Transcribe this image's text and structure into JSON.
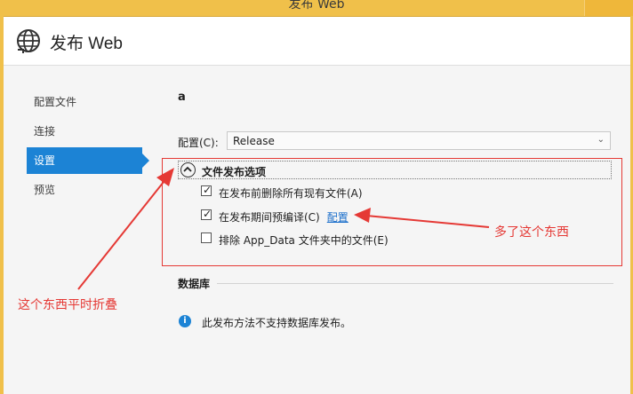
{
  "window": {
    "title": "发布 Web"
  },
  "header": {
    "title": "发布 Web"
  },
  "nav": {
    "items": [
      {
        "label": "配置文件",
        "active": false
      },
      {
        "label": "连接",
        "active": false
      },
      {
        "label": "设置",
        "active": true
      },
      {
        "label": "预览",
        "active": false
      }
    ]
  },
  "settings": {
    "profile_name": "a",
    "config_label": "配置(C):",
    "config_value": "Release",
    "file_publish": {
      "title": "文件发布选项",
      "options": [
        {
          "label": "在发布前删除所有现有文件(A)",
          "checked": true
        },
        {
          "label": "在发布期间预编译(C)",
          "checked": true,
          "link": "配置"
        },
        {
          "label": "排除 App_Data 文件夹中的文件(E)",
          "checked": false
        }
      ]
    },
    "database": {
      "title": "数据库",
      "info": "此发布方法不支持数据库发布。"
    }
  },
  "annotations": {
    "collapsed_note": "这个东西平时折叠",
    "new_item_note": "多了这个东西"
  },
  "colors": {
    "accent": "#1c83d5",
    "annotation": "#e53935",
    "titlebar": "#f0c04a"
  }
}
